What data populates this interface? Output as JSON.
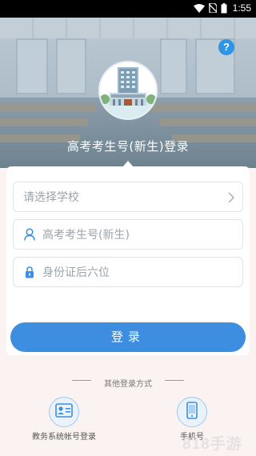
{
  "status_bar": {
    "time": "1:55"
  },
  "header": {
    "help_label": "?",
    "title": "高考考生号(新生)登录"
  },
  "form": {
    "school_placeholder": "请选择学校",
    "exam_id_placeholder": "高考考生号(新生)",
    "id_card_placeholder": "身份证后六位",
    "login_label": "登录"
  },
  "other_login": {
    "title": "其他登录方式",
    "options": [
      {
        "label": "教务系统帐号登录",
        "icon": "id-card-icon"
      },
      {
        "label": "手机号",
        "icon": "phone-icon"
      }
    ]
  },
  "watermark": "818手游网",
  "colors": {
    "accent": "#3d8ee0",
    "help": "#2f93e6"
  }
}
